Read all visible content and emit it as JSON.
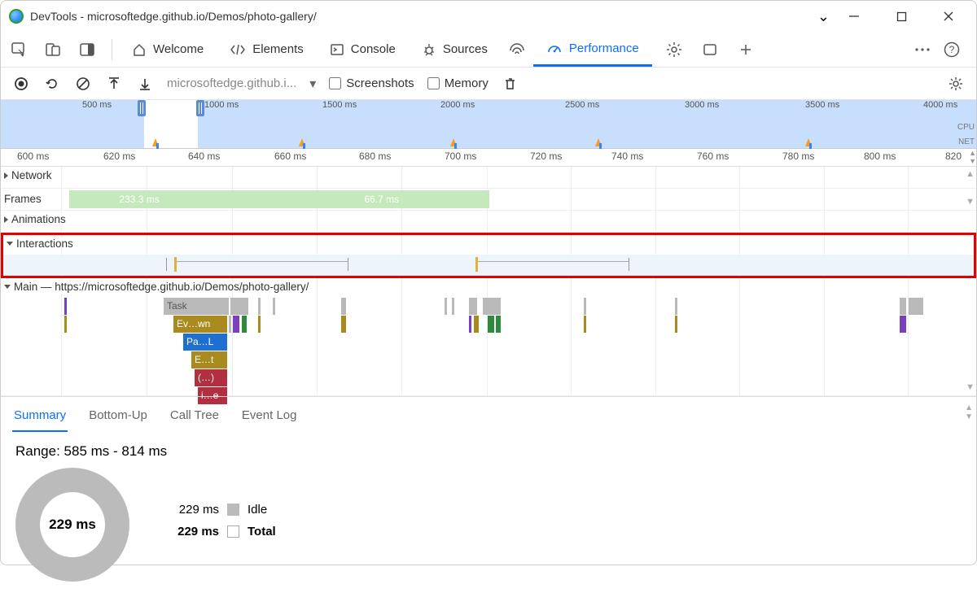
{
  "window": {
    "title": "DevTools - microsoftedge.github.io/Demos/photo-gallery/"
  },
  "tabs": {
    "welcome": "Welcome",
    "elements": "Elements",
    "console": "Console",
    "sources": "Sources",
    "performance": "Performance"
  },
  "toolbar": {
    "url": "microsoftedge.github.i...",
    "screenshots_label": "Screenshots",
    "memory_label": "Memory"
  },
  "overview": {
    "ticks": [
      "500 ms",
      "1000 ms",
      "1500 ms",
      "2000 ms",
      "2500 ms",
      "3000 ms",
      "3500 ms",
      "4000 ms"
    ],
    "side_labels": {
      "cpu": "CPU",
      "net": "NET"
    }
  },
  "detail": {
    "ticks": [
      "600 ms",
      "620 ms",
      "640 ms",
      "660 ms",
      "680 ms",
      "700 ms",
      "720 ms",
      "740 ms",
      "760 ms",
      "780 ms",
      "800 ms",
      "820"
    ]
  },
  "tracks": {
    "network": "Network",
    "frames": "Frames",
    "animations": "Animations",
    "interactions": "Interactions",
    "main_prefix": "Main — ",
    "main_url": "https://microsoftedge.github.io/Demos/photo-gallery/"
  },
  "frames_data": [
    {
      "label": "233.3 ms",
      "left_pct": 7,
      "width_pct": 14.4
    },
    {
      "label": "66.7 ms",
      "left_pct": 28,
      "width_pct": 22.1
    }
  ],
  "flame": {
    "task": "Task",
    "ev": "Ev…wn",
    "pa": "Pa…L",
    "et": "E…t",
    "paren": "(…)",
    "ie": "i…e"
  },
  "bottom_tabs": {
    "summary": "Summary",
    "bottom_up": "Bottom-Up",
    "call_tree": "Call Tree",
    "event_log": "Event Log"
  },
  "summary": {
    "range": "Range: 585 ms - 814 ms",
    "center": "229 ms",
    "idle_ms": "229 ms",
    "idle_label": "Idle",
    "total_ms": "229 ms",
    "total_label": "Total"
  }
}
